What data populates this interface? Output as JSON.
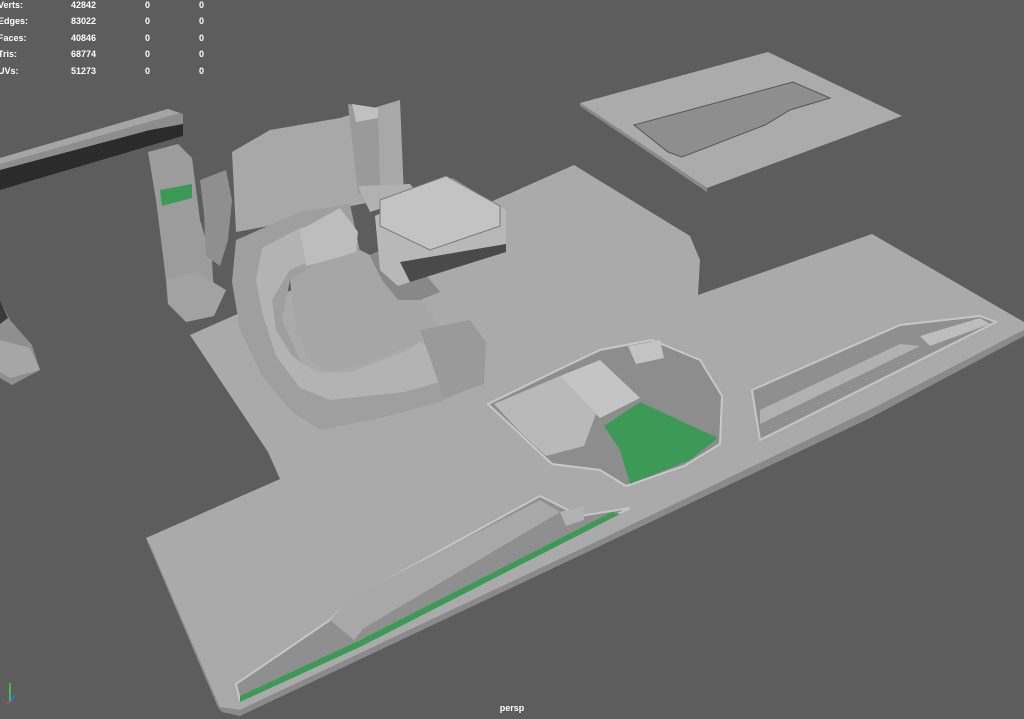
{
  "stats": [
    {
      "label": "Verts:",
      "total": "42842",
      "selected": "0",
      "component": "0"
    },
    {
      "label": "Edges:",
      "total": "83022",
      "selected": "0",
      "component": "0"
    },
    {
      "label": "Faces:",
      "total": "40846",
      "selected": "0",
      "component": "0"
    },
    {
      "label": "Tris:",
      "total": "68774",
      "selected": "0",
      "component": "0"
    },
    {
      "label": "UVs:",
      "total": "51273",
      "selected": "0",
      "component": "0"
    }
  ],
  "camera": "persp",
  "colors": {
    "background": "#5d5d5d",
    "surface": "#a9a9a9",
    "highlight_green": "#3d9a56",
    "dark_edge": "#4a4a4a",
    "axis_y": "#3ed83e",
    "axis_z": "#3a6cff"
  }
}
